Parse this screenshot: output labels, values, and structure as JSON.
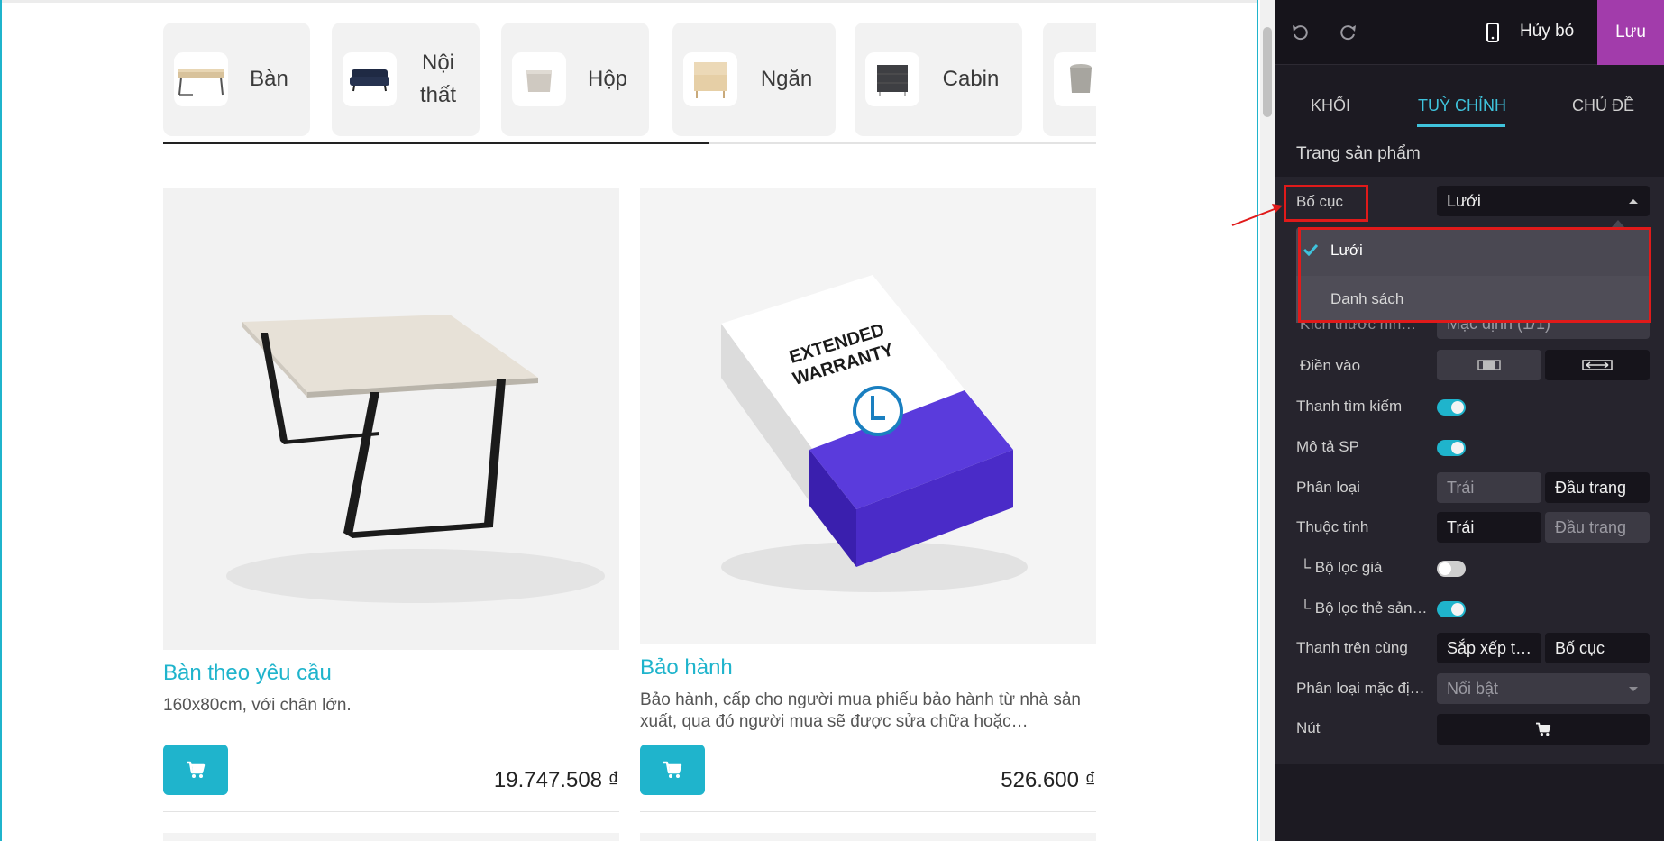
{
  "categories": [
    {
      "label": "Bàn",
      "icon": "desk-thumbnail"
    },
    {
      "label": "Nội thất",
      "icon": "sofa-thumbnail"
    },
    {
      "label": "Hộp",
      "icon": "box-thumbnail"
    },
    {
      "label": "Ngăn",
      "icon": "drawer-thumbnail"
    },
    {
      "label": "Cabin",
      "icon": "cabinet-thumbnail"
    },
    {
      "label": "",
      "icon": "bin-thumbnail"
    }
  ],
  "products": [
    {
      "name": "Bàn theo yêu cầu",
      "description": "160x80cm, với chân lớn.",
      "price": "19.747.508 ₫",
      "image": "table-image",
      "cart_icon": "cart-icon"
    },
    {
      "name": "Bảo hành",
      "description": "Bảo hành, cấp cho người mua phiếu bảo hành từ nhà sản xuất, qua đó người mua sẽ được sửa chữa hoặc…",
      "price": "526.600 ₫",
      "image": "warranty-box-image",
      "box_text": "EXTENDED WARRANTY",
      "cart_icon": "cart-icon"
    }
  ],
  "editor": {
    "toolbar": {
      "undo_icon": "undo-icon",
      "redo_icon": "redo-icon",
      "mobile_icon": "mobile-preview-icon",
      "discard": "Hủy bỏ",
      "save": "Lưu"
    },
    "tabs": [
      "KHỐI",
      "TUỲ CHỈNH",
      "CHỦ ĐỀ"
    ],
    "active_tab": "TUỲ CHỈNH",
    "section_title": "Trang sản phẩm",
    "options": {
      "layout": {
        "label": "Bố cục",
        "value": "Lưới",
        "menu": [
          {
            "label": "Lưới",
            "selected": true
          },
          {
            "label": "Danh sách",
            "selected": false
          }
        ]
      },
      "image_size": {
        "label": "Kích thước hìn…",
        "value": "Mặc định (1/1)"
      },
      "fill": {
        "label": "Điền vào"
      },
      "search_bar": {
        "label": "Thanh tìm kiếm",
        "enabled": true
      },
      "description": {
        "label": "Mô tả SP",
        "enabled": true
      },
      "categories": {
        "label": "Phân loại",
        "left": "Trái",
        "top": "Đầu trang",
        "selected": "Đầu trang"
      },
      "attributes": {
        "label": "Thuộc tính",
        "left": "Trái",
        "top": "Đầu trang",
        "selected": "Trái"
      },
      "price_filter": {
        "label": "Bộ lọc giá",
        "enabled": false
      },
      "tag_filter": {
        "label": "Bộ lọc thẻ sản…",
        "enabled": true
      },
      "top_bar": {
        "label": "Thanh trên cùng",
        "sort": "Sắp xếp t…",
        "layout": "Bố cục"
      },
      "default_sort": {
        "label": "Phân loại mặc đị…",
        "value": "Nổi bật"
      },
      "button": {
        "label": "Nút",
        "icon": "cart-icon"
      }
    }
  },
  "colors": {
    "accent": "#1fb4cc",
    "save": "#a23cab",
    "highlight": "#e01a1a",
    "panel": "#1c1a22"
  }
}
